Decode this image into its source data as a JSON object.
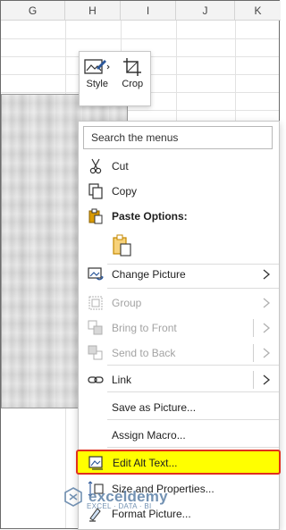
{
  "columns": [
    "G",
    "H",
    "I",
    "J",
    "K"
  ],
  "mini_toolbar": {
    "style_label": "Style",
    "crop_label": "Crop"
  },
  "context_menu": {
    "search_placeholder": "Search the menus",
    "items": {
      "cut": "Cut",
      "copy": "Copy",
      "paste_options": "Paste Options:",
      "change_picture": "Change Picture",
      "group": "Group",
      "bring_to_front": "Bring to Front",
      "send_to_back": "Send to Back",
      "link": "Link",
      "save_as_picture": "Save as Picture...",
      "assign_macro": "Assign Macro...",
      "edit_alt_text": "Edit Alt Text...",
      "size_and_properties": "Size and Properties...",
      "format_picture": "Format Picture..."
    }
  },
  "watermark": {
    "brand": "exceldemy",
    "tagline": "EXCEL · DATA · BI"
  },
  "colors": {
    "highlight_fill": "#ffff00",
    "highlight_border": "#e0301e",
    "accent": "#2b579a",
    "paste_icon": "#d99a00"
  }
}
